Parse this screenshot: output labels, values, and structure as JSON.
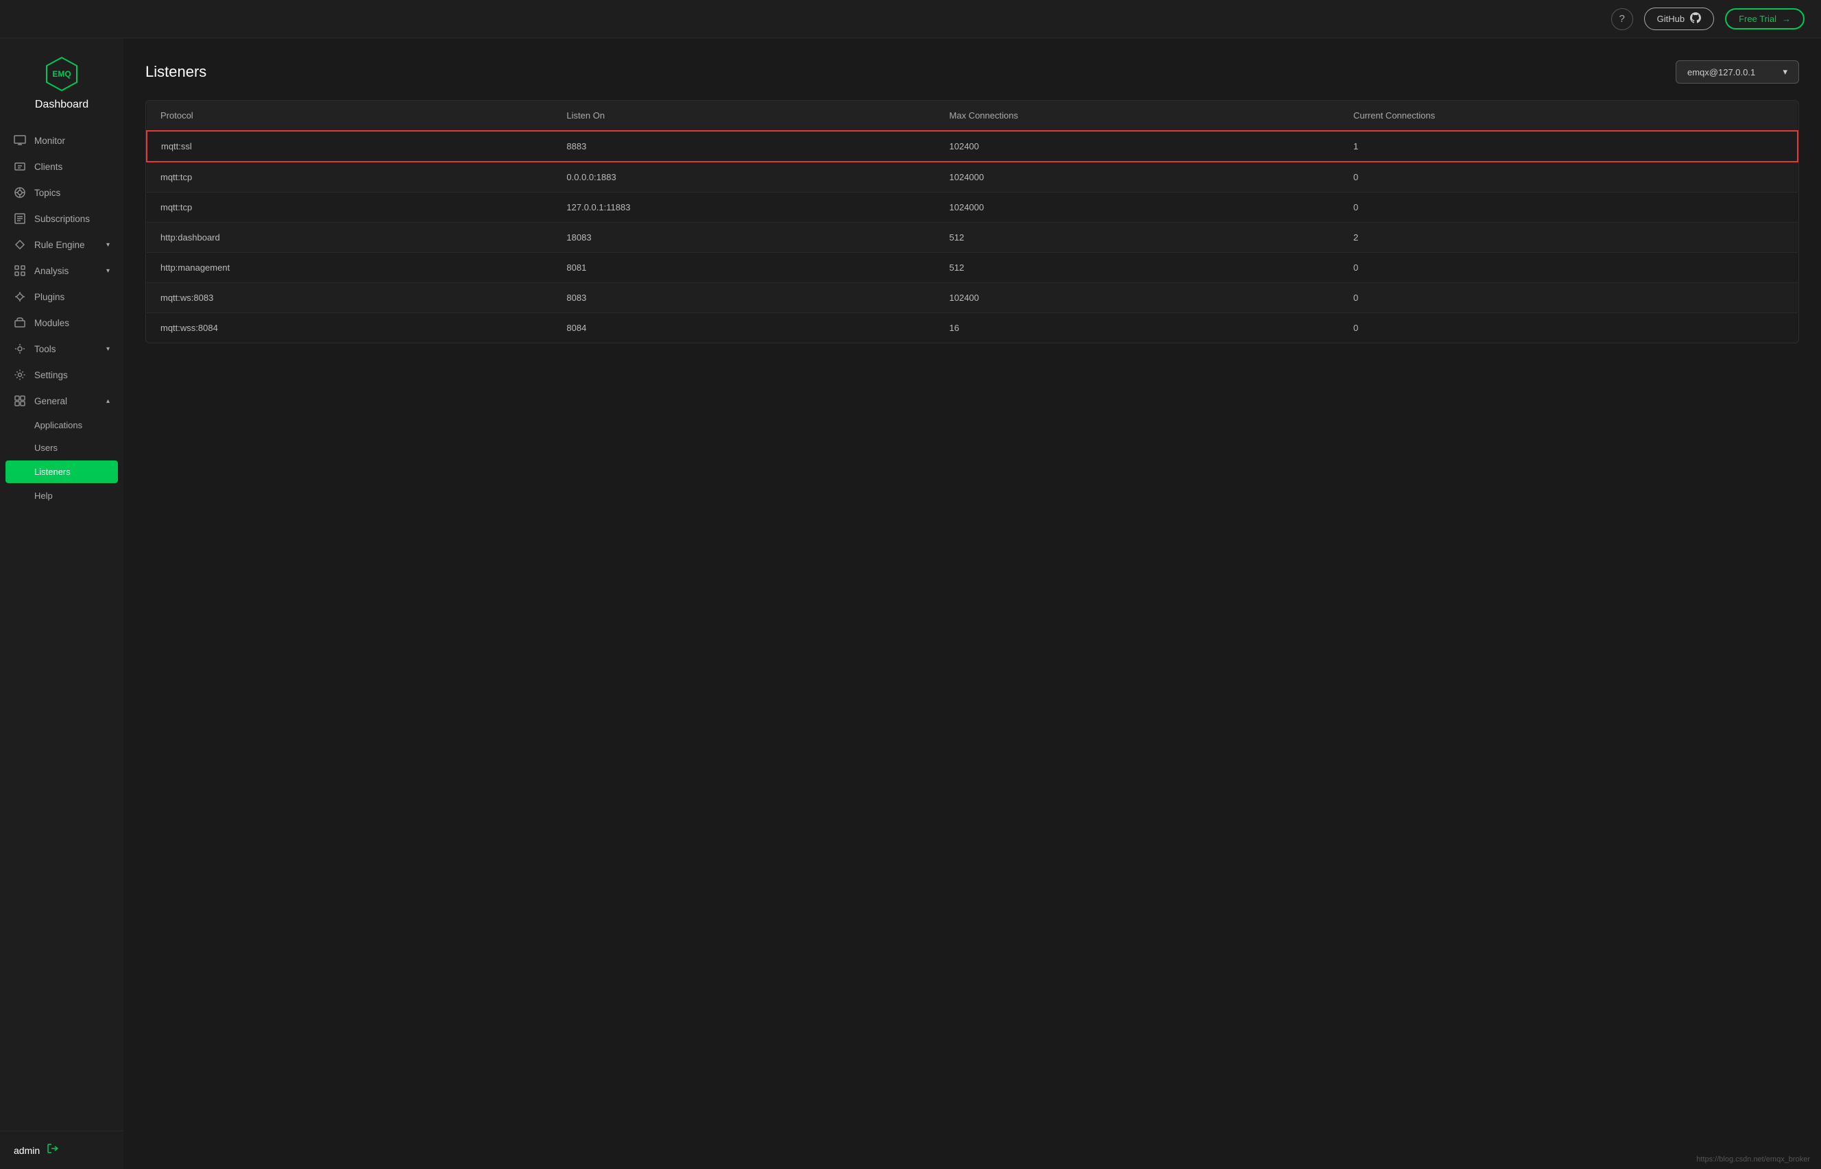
{
  "topbar": {
    "help_label": "?",
    "github_label": "GitHub",
    "free_trial_label": "Free Trial",
    "github_icon": "⬡",
    "arrow_icon": "→"
  },
  "sidebar": {
    "brand": "Dashboard",
    "logo_text": "EMQ",
    "nav_items": [
      {
        "id": "monitor",
        "label": "Monitor",
        "icon": "monitor"
      },
      {
        "id": "clients",
        "label": "Clients",
        "icon": "clients"
      },
      {
        "id": "topics",
        "label": "Topics",
        "icon": "topics"
      },
      {
        "id": "subscriptions",
        "label": "Subscriptions",
        "icon": "subscriptions"
      },
      {
        "id": "rule-engine",
        "label": "Rule Engine",
        "icon": "rule-engine",
        "hasChevron": true
      },
      {
        "id": "analysis",
        "label": "Analysis",
        "icon": "analysis",
        "hasChevron": true
      },
      {
        "id": "plugins",
        "label": "Plugins",
        "icon": "plugins"
      },
      {
        "id": "modules",
        "label": "Modules",
        "icon": "modules"
      },
      {
        "id": "tools",
        "label": "Tools",
        "icon": "tools",
        "hasChevron": true
      },
      {
        "id": "settings",
        "label": "Settings",
        "icon": "settings"
      },
      {
        "id": "general",
        "label": "General",
        "icon": "general",
        "hasChevron": true
      }
    ],
    "sub_items": [
      {
        "id": "applications",
        "label": "Applications",
        "parent": "general"
      },
      {
        "id": "users",
        "label": "Users",
        "parent": "general"
      },
      {
        "id": "listeners",
        "label": "Listeners",
        "parent": "general",
        "active": true
      },
      {
        "id": "help",
        "label": "Help",
        "parent": "general"
      }
    ],
    "user": "admin",
    "logout_icon": "logout"
  },
  "page": {
    "title": "Listeners",
    "server_selector": "emqx@127.0.0.1"
  },
  "table": {
    "columns": [
      "Protocol",
      "Listen On",
      "Max Connections",
      "Current Connections"
    ],
    "rows": [
      {
        "protocol": "mqtt:ssl",
        "listen_on": "8883",
        "max_connections": "102400",
        "current_connections": "1",
        "highlighted": true
      },
      {
        "protocol": "mqtt:tcp",
        "listen_on": "0.0.0.0:1883",
        "max_connections": "1024000",
        "current_connections": "0",
        "highlighted": false
      },
      {
        "protocol": "mqtt:tcp",
        "listen_on": "127.0.0.1:11883",
        "max_connections": "1024000",
        "current_connections": "0",
        "highlighted": false
      },
      {
        "protocol": "http:dashboard",
        "listen_on": "18083",
        "max_connections": "512",
        "current_connections": "2",
        "highlighted": false
      },
      {
        "protocol": "http:management",
        "listen_on": "8081",
        "max_connections": "512",
        "current_connections": "0",
        "highlighted": false
      },
      {
        "protocol": "mqtt:ws:8083",
        "listen_on": "8083",
        "max_connections": "102400",
        "current_connections": "0",
        "highlighted": false
      },
      {
        "protocol": "mqtt:wss:8084",
        "listen_on": "8084",
        "max_connections": "16",
        "current_connections": "0",
        "highlighted": false
      }
    ]
  },
  "footer": {
    "link": "https://blog.csdn.net/emqx_broker"
  }
}
